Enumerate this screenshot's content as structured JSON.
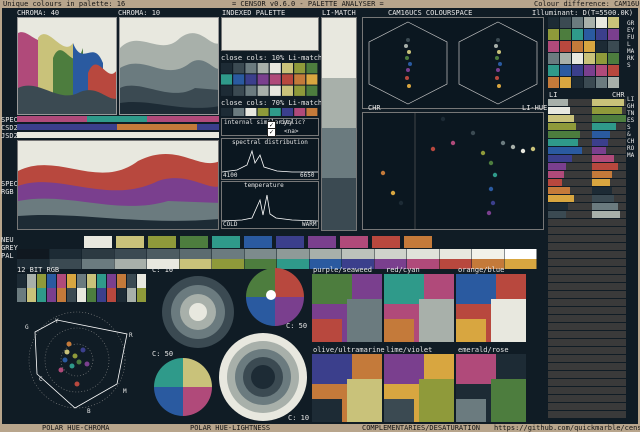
{
  "header": {
    "left": "Unique colours in palette: 16",
    "center": "= CENSOR v0.6.0 - PALETTE ANALYSER =",
    "right": "Colour difference: CAM16UCS"
  },
  "subheader": {
    "chroma_left": "CHROMA: 40",
    "chroma_mid": "CHROMA: 10",
    "indexed": "INDEXED PALETTE",
    "li_match": "LI-MATCH",
    "cam": "CAM16UCS COLOURSPACE",
    "illuminant": "Illuminant: D(T=5500.0K)"
  },
  "side_labels": {
    "spec": "SPEC",
    "csd2": "CSD2",
    "jsd2": "JSD2",
    "spec2": "SPEC",
    "rgb": "RGB",
    "neu": "NEU",
    "grey": "GREY",
    "pal": "PAL"
  },
  "controls": {
    "close_cols_10": "close cols: 10% Li-match",
    "close_cols_70": "close cols: 70% Li-match",
    "internal_similarity": "internal similarity",
    "cyclic": "cyclic?",
    "na": "<na>",
    "spectral_distribution": "spectral distribution",
    "temperature": "temperature",
    "cold": "COLD",
    "warm": "WARM",
    "wl_min": "4100",
    "wl_max": "6650"
  },
  "chr_panel": {
    "chr": "CHR",
    "li_hue": "LI-HUE",
    "li": "LI",
    "chr2": "CHR"
  },
  "right_vertical": "GREYFUL MARKS",
  "right_vertical2": "LIGHTNESS & CHROMA",
  "bit12": "12 BIT RGB",
  "chart_labels": {
    "c10a": "C: 10",
    "c50a": "C: 50",
    "c50b": "C: 50",
    "c10b": "C: 10"
  },
  "voronoi": {
    "purple_seaweed": "purple/seaweed",
    "red_cyan": "red/cyan",
    "orange_blue": "orange/blue",
    "olive_ultramarine": "olive/ultramarine",
    "lime_violet": "lime/violet",
    "emerald_rose": "emerald/rose"
  },
  "polar_letters": {
    "G": "G",
    "Y": "Y",
    "R": "R",
    "C": "C",
    "M": "M",
    "B": "B"
  },
  "footer": {
    "polar_hue_chroma": "POLAR HUE-CHROMA",
    "polar_hue_lightness": "POLAR HUE-LIGHTNESS",
    "complementaries": "COMPLEMENTARIES/DESATURATION",
    "url": "https://github.com/quickmarble/censor"
  },
  "palette": [
    "#1d2b35",
    "#3b4a52",
    "#6b7b7f",
    "#a8b0aa",
    "#e8e8df",
    "#c9c27a",
    "#8f9a3a",
    "#4d7d3e",
    "#2f9a8a",
    "#2a5aa0",
    "#3b3f8c",
    "#7a3f8e",
    "#b04a7a",
    "#b8483e",
    "#c47a3a",
    "#d8a640"
  ]
}
